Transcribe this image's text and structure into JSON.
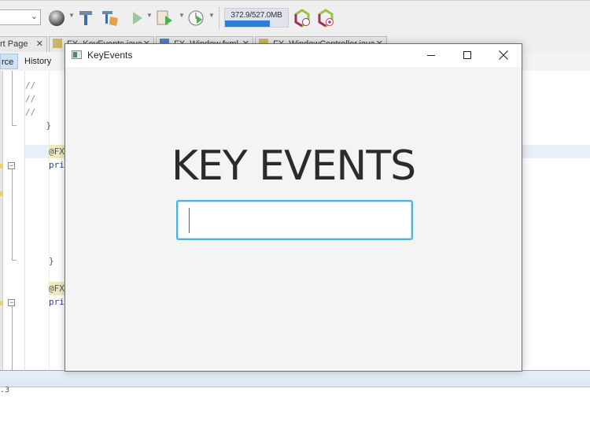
{
  "ide": {
    "toolbar": {
      "icons": [
        "globe-icon",
        "build-hammer-icon",
        "clean-build-icon",
        "run-icon",
        "debug-icon",
        "profile-icon"
      ],
      "memory": {
        "text": "372.9/527.0MB",
        "used_fraction": 0.71
      },
      "gc_icons": [
        "gc-clock-icon",
        "gc-target-icon"
      ]
    },
    "editor_tabs": [
      {
        "label": "rt Page",
        "icon": "start-page-icon"
      },
      {
        "label": "FX_KeyEvents.java",
        "icon": "java-file-icon"
      },
      {
        "label": "FX_Window.fxml",
        "icon": "fxml-file-icon"
      },
      {
        "label": "FX_WindowController.java",
        "icon": "java-file-icon"
      }
    ],
    "source_tabs": {
      "source": "rce",
      "history": "History"
    },
    "code_lines": [
      {
        "text": "//"
      },
      {
        "text": "//"
      },
      {
        "text": "//"
      },
      {
        "text": "    }"
      },
      {
        "text": "    @FX"
      },
      {
        "text": "    pri"
      },
      {
        "text": "    }"
      },
      {
        "text": "    @FX"
      },
      {
        "text": "    pri"
      }
    ],
    "output_text": ".3"
  },
  "fx_window": {
    "title": "KeyEvents",
    "heading": "KEY EVENTS",
    "input": {
      "value": "",
      "placeholder": ""
    },
    "controls": {
      "minimize": "minimize",
      "maximize": "maximize",
      "close": "close"
    }
  }
}
